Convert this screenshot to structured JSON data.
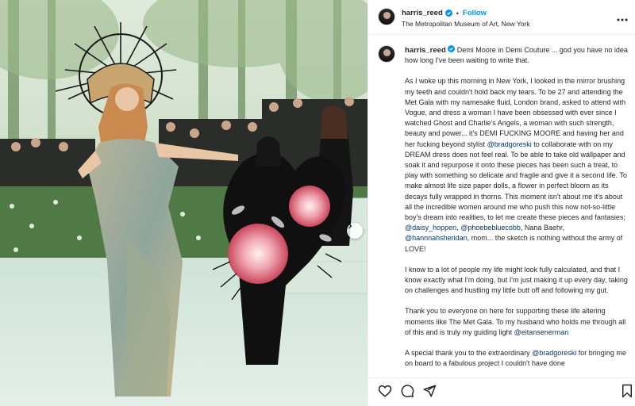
{
  "post": {
    "username": "harris_reed",
    "follow_label": "Follow",
    "separator": "•",
    "location": "The Metropolitan Museum of Art, New York"
  },
  "caption": {
    "username": "harris_reed",
    "lead": "Demi Moore in Demi Couture ... god you have no idea how long I've been waiting to write that.",
    "p1_a": "As I woke up this morning in New York, I looked in the mirror brushing my teeth and couldn't hold back my tears. To be 27 and attending the Met Gala with my namesake fluid, London brand, asked to attend with Vogue, and dress a woman I have been obsessed with ever since I watched Ghost and Charlie's Angels, a woman with such strength, beauty and power... it's DEMI FUCKING MOORE and having her and her fucking beyond stylist",
    "mention_bradgoreski": "@bradgoreski",
    "p1_b": "to collaborate with on my DREAM dress does not feel real. To be able to take old wallpaper and soak it and repurpose it onto these pieces has been such a treat, to play with something so delicate and fragile and give it a second life. To make almost life size paper dolls, a flower in perfect bloom as its decays fully wrapped in thorns. This moment isn't about me it's about all the incredible women around me who push this now not-so-little boy's dream into realities, to let me create these pieces and fantasies;",
    "mention_daisy": "@daisy_hoppen",
    "comma": ",",
    "mention_phoebe": "@phoebebluecobb",
    "p1_c": ", Nana Baehr,",
    "mention_hannah": "@hannnahsheridan",
    "p1_d": ", mom... the sketch is nothing without the army of LOVE!",
    "p2": "I know to a lot of people my life might look fully calculated, and that I know exactly what I'm doing, but I'm just making it up every day, taking on challenges and hustling my little butt off and following my gut.",
    "p3_a": "Thank you to everyone on here for supporting these life altering moments like The Met Gala. To my husband who holds me through all of this and is truly my guiding light",
    "mention_eitan": "@eitansenerman",
    "p4_a": "A special thank you to the extraordinary",
    "mention_brad2": "@bradgoreski",
    "p4_b": "for bringing me on board to a fabulous project I couldn't have done"
  },
  "icons": {
    "verified": "verified-badge-icon",
    "more": "more-options-icon",
    "like": "heart-icon",
    "comment": "comment-icon",
    "share": "share-icon",
    "save": "bookmark-icon",
    "next": "chevron-right-icon"
  },
  "colors": {
    "link": "#00376b",
    "follow": "#0095f6",
    "verified": "#0095f6"
  }
}
